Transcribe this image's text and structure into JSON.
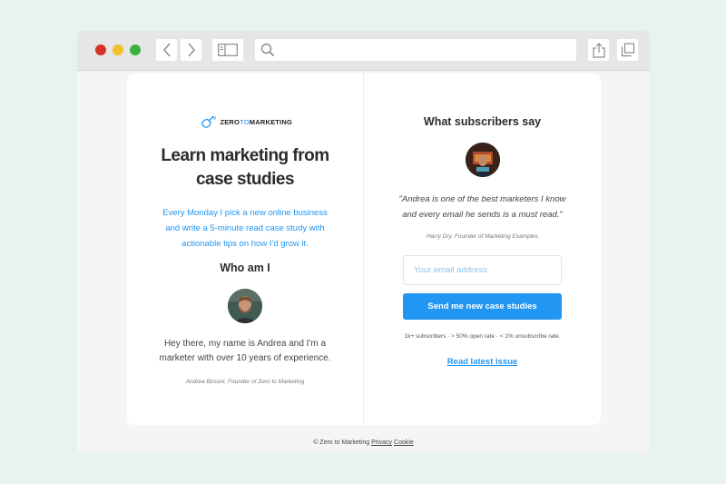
{
  "brand": {
    "logo_prefix": "ZERO",
    "logo_to": "TO",
    "logo_suffix": "MARKETING"
  },
  "left": {
    "headline": "Learn marketing from case studies",
    "intro": "Every Monday I pick a new online business and write a 5-minute read case study with actionable tips on how I'd grow it.",
    "who_title": "Who am I",
    "bio": "Hey there, my name is Andrea and I'm a marketer with over 10 years of experience.",
    "bio_sign": "Andrea Bosoni, Founder of Zero to Marketing"
  },
  "right": {
    "testimonial_title": "What subscribers say",
    "quote": "\"Andrea is one of the best marketers I know and every email he sends is a must read.\"",
    "quote_sign": "Harry Dry, Founder of Marketing Examples",
    "email_placeholder": "Your email address",
    "submit_label": "Send me new case studies",
    "stats": "1k+ subscribers · > 50% open rate · < 1% unsubscribe rate.",
    "latest_link": "Read latest issue"
  },
  "footer": {
    "copyright": "© Zero to Marketing",
    "privacy": "Privacy",
    "cookie": "Cookie"
  },
  "colors": {
    "accent": "#2196f3",
    "background": "#e8f3f1",
    "traffic_red": "#d7332b",
    "traffic_yellow": "#f2c029",
    "traffic_green": "#37b33d"
  },
  "icons": {
    "back": "chevron-left-icon",
    "forward": "chevron-right-icon",
    "sidebar": "sidebar-icon",
    "search": "search-icon",
    "share": "share-icon",
    "tabs": "tabs-icon"
  }
}
